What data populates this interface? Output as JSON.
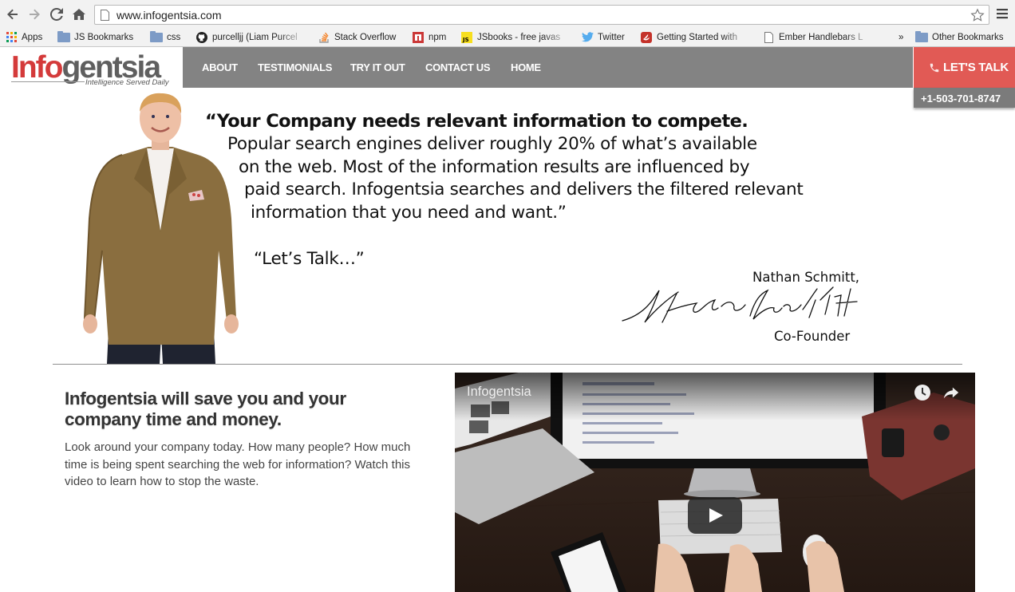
{
  "browser": {
    "url": "www.infogentsia.com",
    "bookmarks": [
      {
        "label": "Apps",
        "icon": "apps-grid-icon"
      },
      {
        "label": "JS Bookmarks",
        "icon": "folder-icon"
      },
      {
        "label": "css",
        "icon": "folder-icon"
      },
      {
        "label": "purcelljj (Liam Purcel",
        "icon": "github-icon"
      },
      {
        "label": "Stack Overflow",
        "icon": "stackoverflow-icon"
      },
      {
        "label": "npm",
        "icon": "npm-icon"
      },
      {
        "label": "JSbooks - free javas",
        "icon": "jsbooks-icon"
      },
      {
        "label": "Twitter",
        "icon": "twitter-icon"
      },
      {
        "label": "Getting Started with",
        "icon": "ember-icon"
      },
      {
        "label": "Ember Handlebars L",
        "icon": "page-icon"
      },
      {
        "label": "»",
        "icon": "chevron-icon"
      },
      {
        "label": "Other Bookmarks",
        "icon": "folder-icon"
      }
    ]
  },
  "site": {
    "logo": {
      "part1": "Info",
      "part2": "gentsia",
      "tagline": "Intelligence Served Daily"
    },
    "nav": [
      "ABOUT",
      "TESTIMONIALS",
      "TRY IT OUT",
      "CONTACT US",
      "HOME"
    ],
    "cta": {
      "label": "LET'S TALK",
      "phone": "+1-503-701-8747"
    },
    "quote": {
      "line1": "“Your Company needs relevant information to compete.",
      "line2": "Popular search engines deliver roughly 20% of what’s available",
      "line3": "on the web. Most of the information results are influenced by",
      "line4": "paid search. Infogentsia searches and delivers the filtered relevant",
      "line5": "information that you need and want.”",
      "line6": "“Let’s Talk…”"
    },
    "signature": {
      "name": "Nathan Schmitt,",
      "handwritten": "Nathan Schmitt",
      "role": "Co-Founder"
    },
    "section": {
      "heading": "Infogentsia will save you and your company time and money.",
      "body": "Look around your company today. How many people? How much time is being spent searching the web for information? Watch this video to learn how to stop the waste."
    },
    "video": {
      "title": "Infogentsia"
    }
  },
  "colors": {
    "accent_red": "#e15a55",
    "nav_gray": "#838383",
    "logo_red": "#d43a3a"
  }
}
